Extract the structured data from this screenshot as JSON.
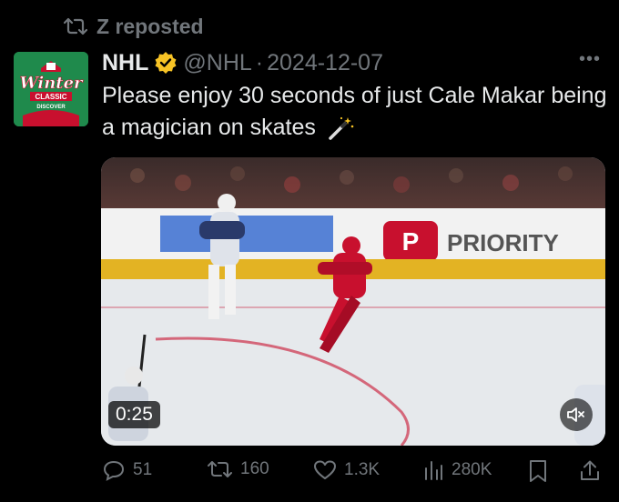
{
  "repost": {
    "label": "Z reposted",
    "icon": "repost-icon"
  },
  "author": {
    "name": "NHL",
    "verified_icon": "verified-badge-icon",
    "handle": "@NHL",
    "separator": "·",
    "date": "2024-12-07",
    "avatar_text": "Winter Classic",
    "avatar_subtext": "DISCOVER",
    "avatar_color": "#1f8a4c"
  },
  "tweet": {
    "text": "Please enjoy 30 seconds of just Cale Makar being a magician on skates",
    "emoji_icon": "magic-wand-icon"
  },
  "media": {
    "duration": "0:25",
    "board_sign": "PRIORITY",
    "mute_icon": "mute-icon"
  },
  "actions": {
    "replies": "51",
    "reposts": "160",
    "likes": "1.3K",
    "views": "280K"
  },
  "colors": {
    "background": "#000000",
    "text": "#e7e9ea",
    "muted": "#71767b",
    "verified": "#f7c325"
  }
}
